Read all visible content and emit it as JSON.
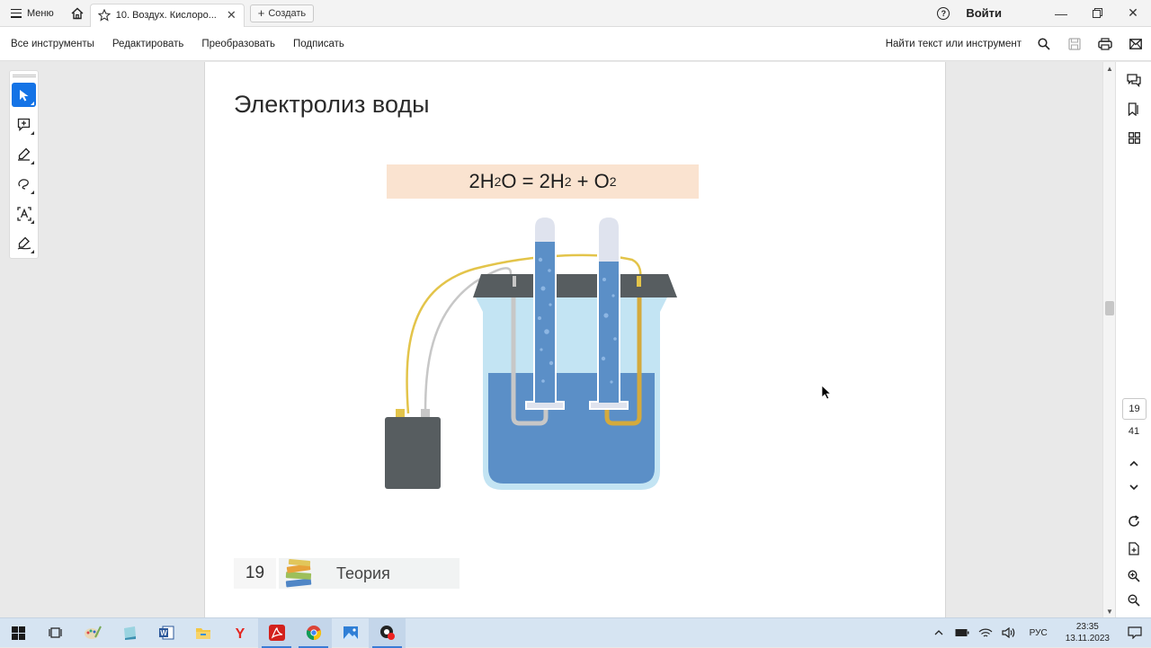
{
  "titlebar": {
    "menu_label": "Меню",
    "tab_title": "10. Воздух. Кислоро...",
    "create_label": "Создать",
    "login_label": "Войти"
  },
  "toolbar": {
    "items": [
      "Все инструменты",
      "Редактировать",
      "Преобразовать",
      "Подписать"
    ],
    "find_label": "Найти текст или инструмент"
  },
  "left_tools": [
    "select-icon",
    "add-comment-icon",
    "highlight-pen-icon",
    "draw-lasso-icon",
    "text-recognition-icon",
    "fill-sign-icon"
  ],
  "document": {
    "title": "Электролиз воды",
    "formula": {
      "lhs_coef": "2H",
      "lhs_sub": "2",
      "lhs_tail": "O",
      "eq": " = ",
      "rhs1_coef": "2H",
      "rhs1_sub": "2",
      "plus": " + ",
      "rhs2": "O",
      "rhs2_sub": "2"
    },
    "page_number": "19",
    "section_label": "Теория"
  },
  "page_nav": {
    "current": "19",
    "total": "41"
  },
  "colors": {
    "accent": "#1473e6",
    "formula_bg": "#fae3d0",
    "water": "#5b8fc7",
    "beaker_glass": "#c3e4f3",
    "lid": "#575d60",
    "battery": "#575d60",
    "wire_yellow": "#e3c44a",
    "wire_gray": "#c7c7c7"
  },
  "taskbar": {
    "apps": [
      "windows-start-icon",
      "task-view-icon",
      "paint-icon",
      "notepad-icon",
      "word-icon",
      "file-explorer-icon",
      "yandex-browser-icon",
      "acrobat-icon",
      "chrome-icon",
      "photos-icon",
      "screen-recorder-icon"
    ],
    "language": "РУС",
    "time": "23:35",
    "date": "13.11.2023"
  }
}
